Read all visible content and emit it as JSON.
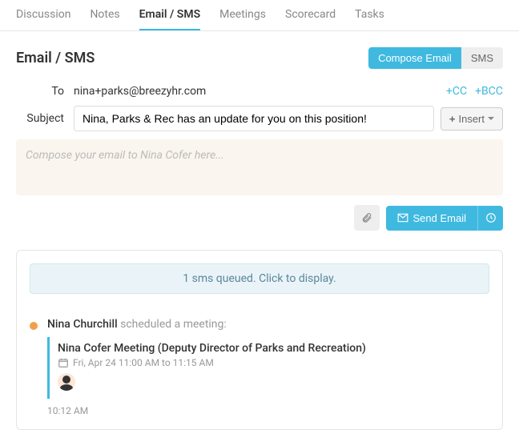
{
  "tabs": [
    {
      "label": "Discussion"
    },
    {
      "label": "Notes"
    },
    {
      "label": "Email / SMS"
    },
    {
      "label": "Meetings"
    },
    {
      "label": "Scorecard"
    },
    {
      "label": "Tasks"
    }
  ],
  "page_title": "Email / SMS",
  "header_buttons": {
    "compose_email": "Compose Email",
    "sms": "SMS"
  },
  "form": {
    "to_label": "To",
    "to_value": "nina+parks@breezyhr.com",
    "cc_label": "+CC",
    "bcc_label": "+BCC",
    "subject_label": "Subject",
    "subject_value": "Nina, Parks & Rec has an update for you on this position!",
    "insert_label": "Insert",
    "compose_placeholder": "Compose your email to Nina Cofer here..."
  },
  "actions": {
    "send_label": "Send Email"
  },
  "thread": {
    "queued_message": "1 sms queued. Click to display.",
    "activity": {
      "author": "Nina Churchill",
      "action": " scheduled a meeting:",
      "meeting_title": "Nina Cofer Meeting (Deputy Director of Parks and Recreation)",
      "meeting_time": "Fri, Apr 24 11:00 AM to 11:15 AM",
      "timestamp": "10:12 AM"
    }
  }
}
